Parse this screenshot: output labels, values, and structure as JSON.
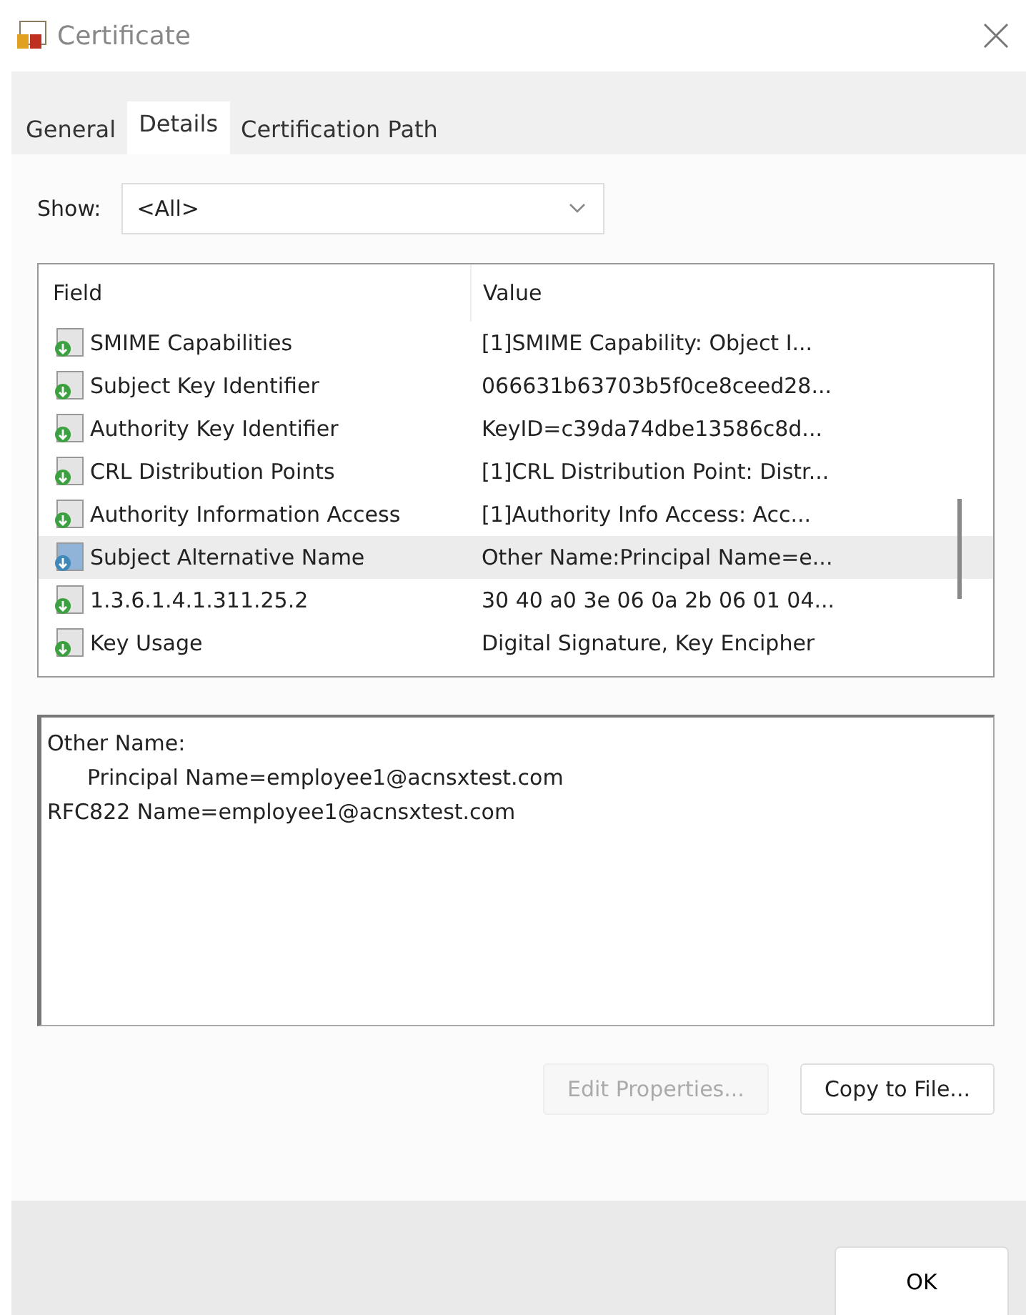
{
  "window": {
    "title": "Certificate"
  },
  "tabs": [
    {
      "label": "General",
      "selected": false
    },
    {
      "label": "Details",
      "selected": true
    },
    {
      "label": "Certification Path",
      "selected": false
    }
  ],
  "show": {
    "label": "Show:",
    "value": "<All>"
  },
  "table": {
    "columns": [
      "Field",
      "Value"
    ],
    "rows": [
      {
        "field": "SMIME Capabilities",
        "value": "[1]SMIME Capability: Object I...",
        "selected": false
      },
      {
        "field": "Subject Key Identifier",
        "value": "066631b63703b5f0ce8ceed28...",
        "selected": false
      },
      {
        "field": "Authority Key Identifier",
        "value": "KeyID=c39da74dbe13586c8d...",
        "selected": false
      },
      {
        "field": "CRL Distribution Points",
        "value": "[1]CRL Distribution Point: Distr...",
        "selected": false
      },
      {
        "field": "Authority Information Access",
        "value": "[1]Authority Info Access: Acc...",
        "selected": false
      },
      {
        "field": "Subject Alternative Name",
        "value": "Other Name:Principal Name=e...",
        "selected": true
      },
      {
        "field": "1.3.6.1.4.1.311.25.2",
        "value": "30 40 a0 3e 06 0a 2b 06 01 04...",
        "selected": false
      },
      {
        "field": "Key Usage",
        "value": "Digital Signature, Key Encipher",
        "selected": false
      }
    ]
  },
  "details": [
    {
      "text": "Other Name:",
      "indent": false
    },
    {
      "text": "Principal Name=employee1@acnsxtest.com",
      "indent": true
    },
    {
      "text": "RFC822 Name=employee1@acnsxtest.com",
      "indent": false
    }
  ],
  "buttons": [
    {
      "label": "Edit Properties...",
      "disabled": true
    },
    {
      "label": "Copy to File...",
      "disabled": false
    }
  ],
  "ok_button": "OK"
}
